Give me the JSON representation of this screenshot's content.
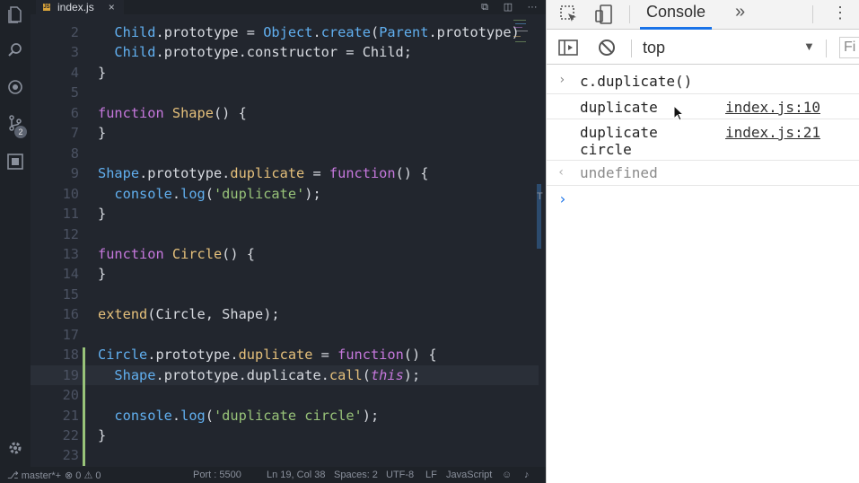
{
  "editor": {
    "tab": {
      "filename": "index.js",
      "close": "×"
    },
    "lines": [
      {
        "n": "2",
        "tokens": [
          [
            "  ",
            "p"
          ],
          [
            "Child",
            "cl"
          ],
          [
            ".prototype = ",
            "p"
          ],
          [
            "Object",
            "cl"
          ],
          [
            ".",
            "p"
          ],
          [
            "create",
            "cl"
          ],
          [
            "(",
            "p"
          ],
          [
            "Parent",
            "cl"
          ],
          [
            ".prototype)",
            "p"
          ]
        ]
      },
      {
        "n": "3",
        "tokens": [
          [
            "  ",
            "p"
          ],
          [
            "Child",
            "cl"
          ],
          [
            ".prototype.constructor = Child;",
            "p"
          ]
        ]
      },
      {
        "n": "4",
        "tokens": [
          [
            "}",
            "p"
          ]
        ]
      },
      {
        "n": "5",
        "tokens": []
      },
      {
        "n": "6",
        "tokens": [
          [
            "function ",
            "kw"
          ],
          [
            "Shape",
            "fn"
          ],
          [
            "() {",
            "p"
          ]
        ]
      },
      {
        "n": "7",
        "tokens": [
          [
            "}",
            "p"
          ]
        ]
      },
      {
        "n": "8",
        "tokens": []
      },
      {
        "n": "9",
        "tokens": [
          [
            "Shape",
            "cl"
          ],
          [
            ".prototype.",
            "p"
          ],
          [
            "duplicate",
            "prop"
          ],
          [
            " = ",
            "p"
          ],
          [
            "function",
            "kw"
          ],
          [
            "() {",
            "p"
          ]
        ]
      },
      {
        "n": "10",
        "tokens": [
          [
            "  ",
            "p"
          ],
          [
            "console",
            "cl"
          ],
          [
            ".",
            "p"
          ],
          [
            "log",
            "cl"
          ],
          [
            "(",
            "p"
          ],
          [
            "'duplicate'",
            "str"
          ],
          [
            ");",
            "p"
          ]
        ]
      },
      {
        "n": "11",
        "tokens": [
          [
            "}",
            "p"
          ]
        ]
      },
      {
        "n": "12",
        "tokens": []
      },
      {
        "n": "13",
        "tokens": [
          [
            "function ",
            "kw"
          ],
          [
            "Circle",
            "fn"
          ],
          [
            "() {",
            "p"
          ]
        ]
      },
      {
        "n": "14",
        "tokens": [
          [
            "}",
            "p"
          ]
        ]
      },
      {
        "n": "15",
        "tokens": []
      },
      {
        "n": "16",
        "tokens": [
          [
            "extend",
            "prop"
          ],
          [
            "(Circle, Shape);",
            "p"
          ]
        ]
      },
      {
        "n": "17",
        "tokens": []
      },
      {
        "n": "18",
        "tokens": [
          [
            "Circle",
            "cl"
          ],
          [
            ".prototype.",
            "p"
          ],
          [
            "duplicate",
            "prop"
          ],
          [
            " = ",
            "p"
          ],
          [
            "function",
            "kw"
          ],
          [
            "() {",
            "p"
          ]
        ]
      },
      {
        "n": "19",
        "tokens": [
          [
            "  ",
            "p"
          ],
          [
            "Shape",
            "cl"
          ],
          [
            ".prototype.duplicate.",
            "p"
          ],
          [
            "call",
            "prop"
          ],
          [
            "(",
            "p"
          ],
          [
            "this",
            "this"
          ],
          [
            ");",
            "p"
          ]
        ],
        "highlight": true
      },
      {
        "n": "20",
        "tokens": []
      },
      {
        "n": "21",
        "tokens": [
          [
            "  ",
            "p"
          ],
          [
            "console",
            "cl"
          ],
          [
            ".",
            "p"
          ],
          [
            "log",
            "cl"
          ],
          [
            "(",
            "p"
          ],
          [
            "'duplicate circle'",
            "str"
          ],
          [
            ");",
            "p"
          ]
        ]
      },
      {
        "n": "22",
        "tokens": [
          [
            "}",
            "p"
          ]
        ]
      },
      {
        "n": "23",
        "tokens": []
      }
    ],
    "scroll_marker": "T"
  },
  "activity": {
    "scm_badge": "2"
  },
  "status": {
    "branch": "master*+",
    "errors": "0",
    "warnings": "0",
    "port": "Port : 5500",
    "position": "Ln 19, Col 38",
    "spaces": "Spaces: 2",
    "encoding": "UTF-8",
    "eol": "LF",
    "language": "JavaScript"
  },
  "devtools": {
    "tab_console": "Console",
    "more_tabs": "»",
    "context": "top",
    "filter_placeholder": "Fi",
    "console": {
      "input_cmd": "c.duplicate()",
      "log1": "duplicate",
      "log1_src": "index.js:10",
      "log2": "duplicate\ncircle",
      "log2_src": "index.js:21",
      "result": "undefined"
    }
  },
  "colors": {
    "accent": "#1a73e8",
    "modified": "#98c379"
  }
}
